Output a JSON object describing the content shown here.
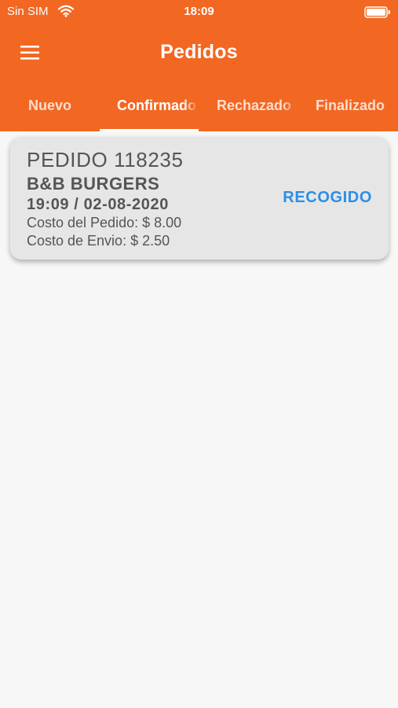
{
  "status_bar": {
    "carrier": "Sin SIM",
    "time": "18:09",
    "wifi_icon": "wifi-icon",
    "battery_icon": "battery-icon"
  },
  "header": {
    "title": "Pedidos",
    "menu_icon": "menu-icon",
    "background_color": "#f26722"
  },
  "tabs": [
    {
      "label": "Nuevo",
      "active": false
    },
    {
      "label": "Confirmado",
      "active": true
    },
    {
      "label": "Rechazado",
      "active": false
    },
    {
      "label": "Finalizado",
      "active": false
    }
  ],
  "orders": [
    {
      "number_label": "PEDIDO 118235",
      "restaurant": "B&B BURGERS",
      "datetime": "19:09 / 02-08-2020",
      "order_cost": "Costo del Pedido: $ 8.00",
      "shipping_cost": "Costo de Envio: $ 2.50",
      "status": "RECOGIDO",
      "status_color": "#2c8ee6"
    }
  ]
}
